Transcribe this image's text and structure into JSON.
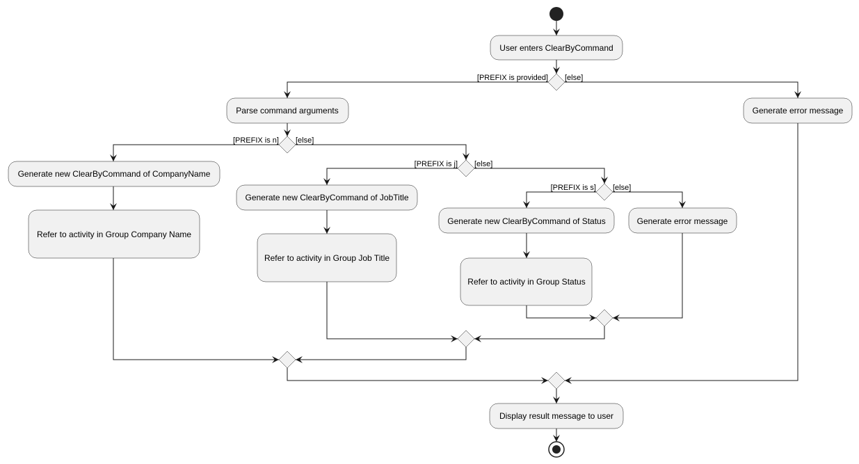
{
  "diagram": {
    "type": "activity",
    "activities": {
      "user_enters": "User enters ClearByCommand",
      "parse_args": "Parse command arguments",
      "error_top": "Generate error message",
      "new_company": "Generate new ClearByCommand of CompanyName",
      "ref_company": "Refer to activity in Group Company Name",
      "new_jobtitle": "Generate new ClearByCommand of JobTitle",
      "ref_jobtitle": "Refer to activity in Group Job Title",
      "new_status": "Generate new ClearByCommand of Status",
      "error_inner": "Generate error message",
      "ref_status": "Refer to activity in Group Status",
      "display_result": "Display result message to user"
    },
    "guards": {
      "d1_yes": "[PREFIX is provided]",
      "d1_no": "[else]",
      "d2_yes": "[PREFIX is n]",
      "d2_no": "[else]",
      "d3_yes": "[PREFIX is j]",
      "d3_no": "[else]",
      "d4_yes": "[PREFIX is s]",
      "d4_no": "[else]"
    },
    "colors": {
      "fill": "#F1F1F1",
      "stroke": "#181818",
      "node": "#222222"
    }
  }
}
